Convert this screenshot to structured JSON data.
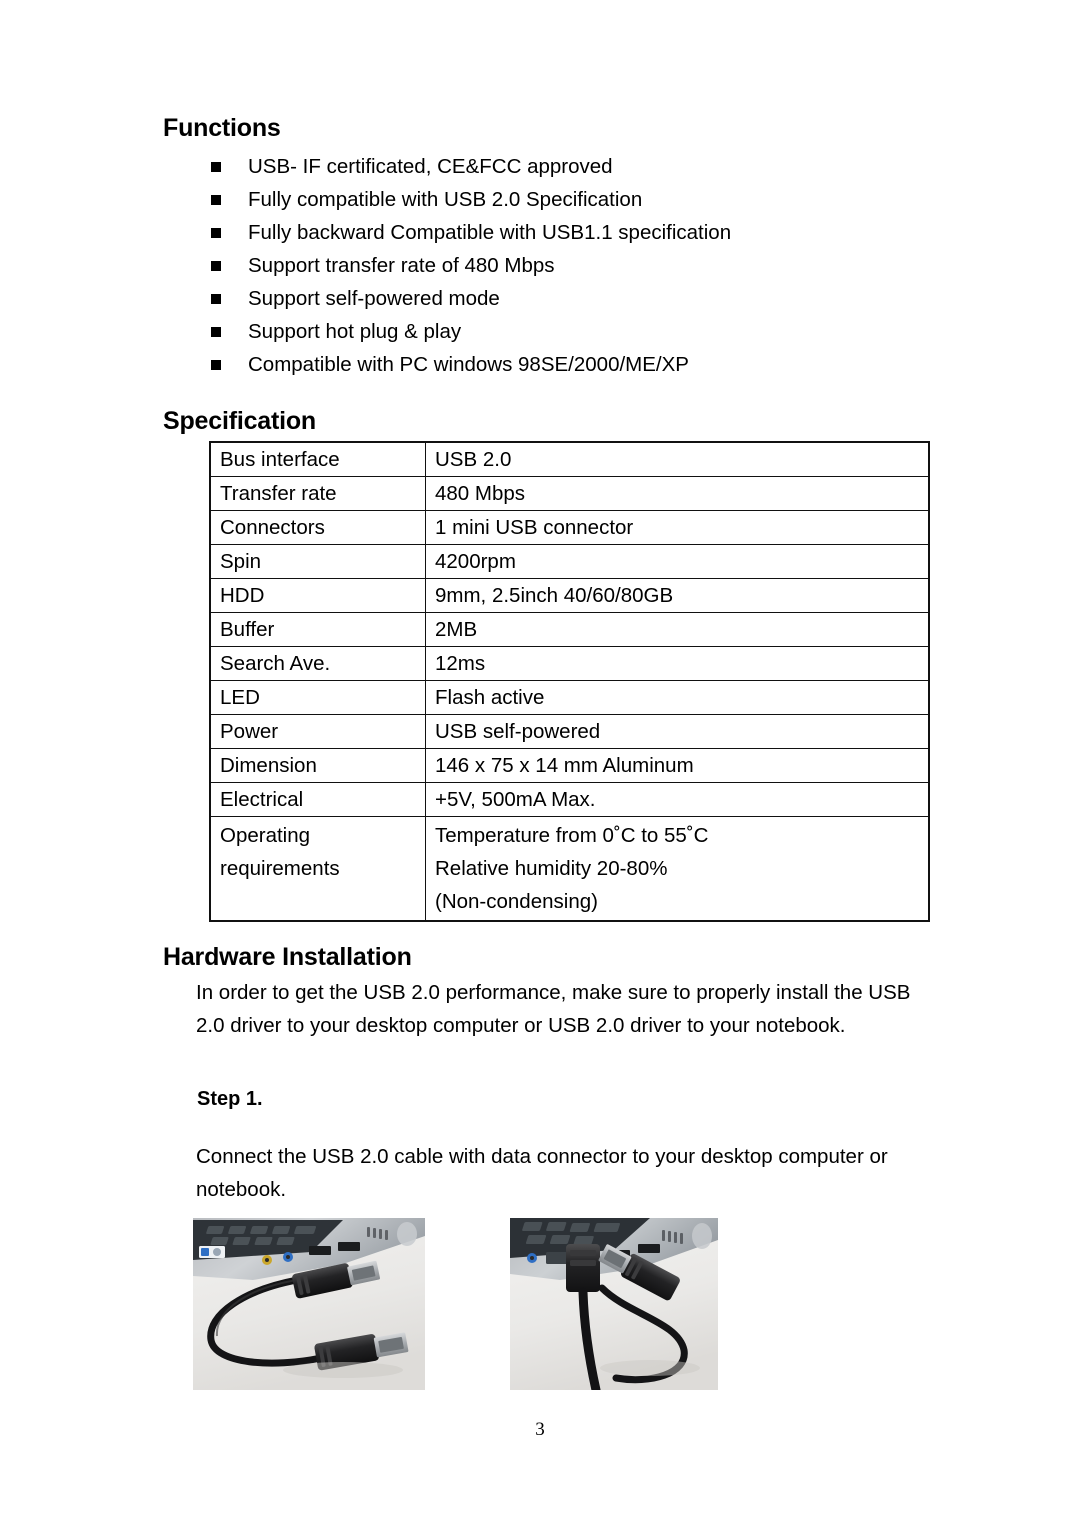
{
  "page": {
    "number": "3"
  },
  "sections": {
    "functions": {
      "heading": "Functions",
      "items": [
        "USB- IF certificated, CE&FCC approved",
        "Fully compatible with USB 2.0 Specification",
        "Fully backward Compatible with USB1.1 specification",
        "Support transfer rate of 480 Mbps",
        "Support self-powered mode",
        "Support hot plug & play",
        "Compatible with PC windows 98SE/2000/ME/XP"
      ]
    },
    "specification": {
      "heading": "Specification",
      "rows": [
        {
          "label": "Bus interface",
          "value": "USB 2.0"
        },
        {
          "label": "Transfer rate",
          "value": "480 Mbps"
        },
        {
          "label": "Connectors",
          "value": "1 mini USB connector"
        },
        {
          "label": "Spin",
          "value": "4200rpm"
        },
        {
          "label": "HDD",
          "value": "9mm, 2.5inch 40/60/80GB"
        },
        {
          "label": "Buffer",
          "value": "2MB"
        },
        {
          "label": "Search Ave.",
          "value": "12ms"
        },
        {
          "label": "LED",
          "value": "Flash active"
        },
        {
          "label": "Power",
          "value": "USB self-powered"
        },
        {
          "label": "Dimension",
          "value": "146 x 75 x 14 mm Aluminum"
        },
        {
          "label": "Electrical",
          "value": "+5V, 500mA Max."
        },
        {
          "label": "Operating\nrequirements",
          "value": "Temperature from 0˚C to 55˚C\nRelative humidity 20-80%\n(Non-condensing)"
        }
      ]
    },
    "hardware_installation": {
      "heading": "Hardware Installation",
      "intro": "In order to get the USB 2.0 performance, make sure to properly install the USB 2.0 driver to your desktop computer or USB 2.0 driver to your notebook.",
      "step_label": "Step 1.",
      "step_text": "Connect the USB 2.0 cable with data connector to your desktop computer or notebook.",
      "photos": [
        {
          "name": "usb-cable-beside-laptop-photo"
        },
        {
          "name": "usb-cable-plugged-into-laptop-photo"
        }
      ]
    }
  }
}
